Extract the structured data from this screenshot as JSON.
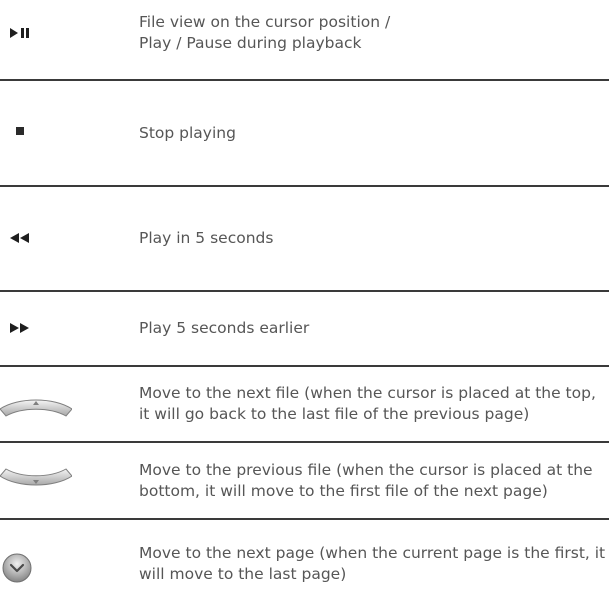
{
  "rows": [
    {
      "icon": "play-pause-icon",
      "lines": [
        "File view on the cursor position /",
        "Play / Pause during playback"
      ]
    },
    {
      "icon": "stop-icon",
      "text": "Stop playing"
    },
    {
      "icon": "rewind-icon",
      "text": "Play in 5 seconds"
    },
    {
      "icon": "fast-forward-icon",
      "text": "Play 5 seconds earlier"
    },
    {
      "icon": "up-arc-button-icon",
      "text": "Move to the next file (when the cursor is placed at the top, it will go back to the last file of the previous page)"
    },
    {
      "icon": "down-arc-button-icon",
      "text": "Move to the previous file (when the cursor is placed at the bottom, it will move to the first file of the next page)"
    },
    {
      "icon": "round-down-button-icon",
      "text": "Move to the next page (when the current page is the first, it will move to the last page)"
    }
  ],
  "colors": {
    "text": "#565656",
    "divider": "#3a3a3a",
    "icon": "#1f1f1f",
    "button_light": "#eeeeee",
    "button_dark": "#8f8f8f"
  }
}
